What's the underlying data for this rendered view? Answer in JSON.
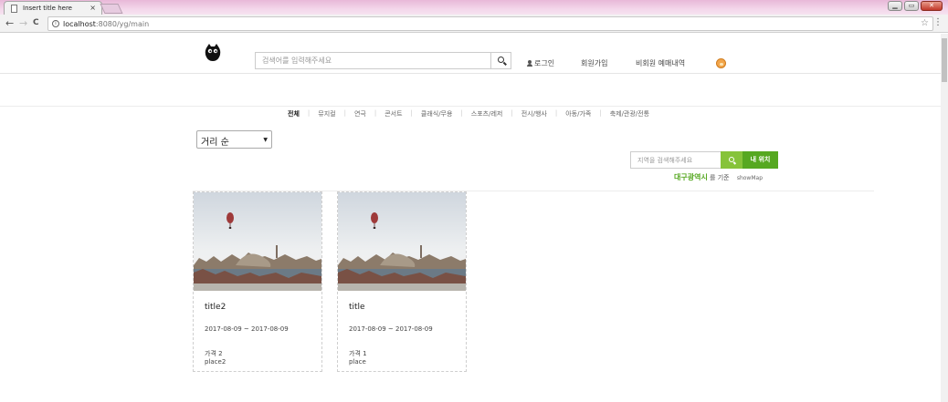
{
  "browser": {
    "tab_title": "Insert title here",
    "tab_close": "×",
    "url_host": "localhost",
    "url_path": ":8080/yg/main",
    "back": "←",
    "forward": "→",
    "reload": "C",
    "star": "☆",
    "menu": "⋮",
    "window_buttons": [
      "▁",
      "▭",
      "✕"
    ]
  },
  "header": {
    "search_placeholder": "검색어를 입력해주세요",
    "login_label": "로그인",
    "signup_label": "회원가입",
    "guest_booking_label": "비회원 예매내역"
  },
  "categories": [
    {
      "label": "전체",
      "active": true
    },
    {
      "label": "뮤지컬",
      "active": false
    },
    {
      "label": "연극",
      "active": false
    },
    {
      "label": "콘서트",
      "active": false
    },
    {
      "label": "클래식/무용",
      "active": false
    },
    {
      "label": "스포츠/레저",
      "active": false
    },
    {
      "label": "전시/행사",
      "active": false
    },
    {
      "label": "아동/가족",
      "active": false
    },
    {
      "label": "축제/관광/전통",
      "active": false
    }
  ],
  "sort": {
    "selected": "거리 순"
  },
  "location": {
    "placeholder": "지역을 검색해주세요",
    "my_location_label": "내 위치",
    "city": "대구광역시",
    "basis_text": "를 기준",
    "show_map_label": "showMap"
  },
  "cards": [
    {
      "title": "title2",
      "date": "2017-08-09 ~ 2017-08-09",
      "price": "가격 2",
      "place": "place2"
    },
    {
      "title": "title",
      "date": "2017-08-09 ~ 2017-08-09",
      "price": "가격 1",
      "place": "place"
    }
  ],
  "colors": {
    "accent_green": "#56a821",
    "search_green": "#86c33a"
  }
}
